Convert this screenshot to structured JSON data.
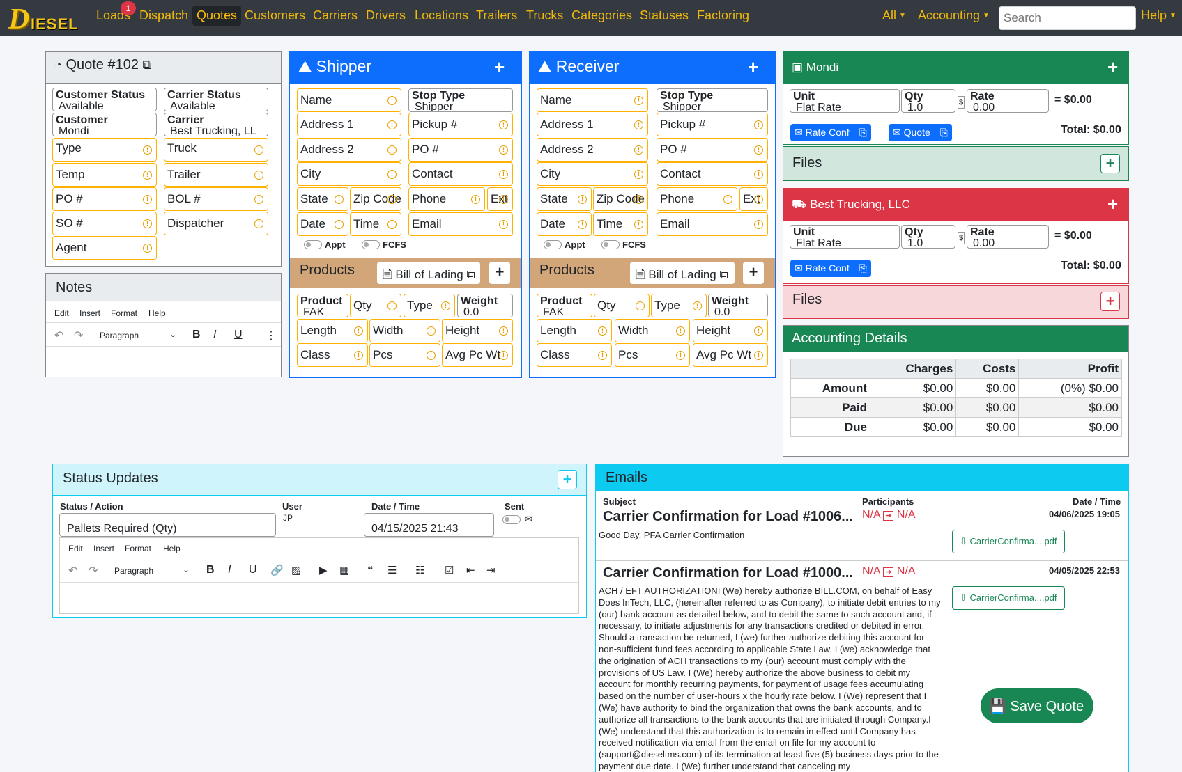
{
  "nav": {
    "logo": "DIESEL",
    "items": [
      "Loads",
      "Dispatch",
      "Quotes",
      "Customers",
      "Carriers",
      "Drivers",
      "Locations",
      "Trailers",
      "Trucks",
      "Categories",
      "Statuses",
      "Factoring"
    ],
    "loads_badge": "1",
    "all": "All",
    "accounting": "Accounting",
    "search_placeholder": "Search",
    "help": "Help"
  },
  "quote": {
    "title": "Quote #102",
    "customer_status_label": "Customer Status",
    "customer_status": "Available",
    "carrier_status_label": "Carrier Status",
    "carrier_status": "Available",
    "customer_label": "Customer",
    "customer": "Mondi",
    "carrier_label": "Carrier",
    "carrier": "Best Trucking, LL",
    "type": "Type",
    "truck": "Truck",
    "temp": "Temp",
    "trailer": "Trailer",
    "po": "PO #",
    "bol": "BOL #",
    "so": "SO #",
    "dispatcher": "Dispatcher",
    "agent": "Agent"
  },
  "notes": {
    "title": "Notes",
    "menu": [
      "Edit",
      "Insert",
      "Format",
      "Help"
    ],
    "paragraph": "Paragraph"
  },
  "shipper": {
    "title": "Shipper",
    "name": "Name",
    "stop_type_label": "Stop Type",
    "stop_type": "Shipper",
    "address1": "Address 1",
    "pickup": "Pickup #",
    "address2": "Address 2",
    "po": "PO #",
    "city": "City",
    "contact": "Contact",
    "state": "State",
    "zip": "Zip Code",
    "phone": "Phone",
    "ext": "Ext",
    "date": "Date",
    "time": "Time",
    "email": "Email",
    "appt": "Appt",
    "fcfs": "FCFS"
  },
  "receiver": {
    "title": "Receiver",
    "name": "Name",
    "stop_type_label": "Stop Type",
    "stop_type": "Shipper",
    "address1": "Address 1",
    "pickup": "Pickup #",
    "address2": "Address 2",
    "po": "PO #",
    "city": "City",
    "contact": "Contact",
    "state": "State",
    "zip": "Zip Code",
    "phone": "Phone",
    "ext": "Ext",
    "date": "Date",
    "time": "Time",
    "email": "Email",
    "appt": "Appt",
    "fcfs": "FCFS"
  },
  "products": {
    "title": "Products",
    "bol": "Bill of Lading",
    "product_label": "Product",
    "product": "FAK",
    "qty": "Qty",
    "type": "Type",
    "weight_label": "Weight",
    "weight": "0.0",
    "length": "Length",
    "width": "Width",
    "height": "Height",
    "class": "Class",
    "pcs": "Pcs",
    "avg": "Avg Pc Wt"
  },
  "mondi": {
    "title": "Mondi",
    "unit_label": "Unit",
    "unit": "Flat Rate",
    "qty_label": "Qty",
    "qty": "1.0",
    "rate_label": "Rate",
    "rate": "0.00",
    "dollar": "$",
    "line_total": "= $0.00",
    "rate_conf": "Rate Conf",
    "quote": "Quote",
    "total": "Total: $0.00",
    "files": "Files"
  },
  "best": {
    "title": "Best Trucking, LLC",
    "unit_label": "Unit",
    "unit": "Flat Rate",
    "qty_label": "Qty",
    "qty": "1.0",
    "rate_label": "Rate",
    "rate": "0.00",
    "dollar": "$",
    "line_total": "= $0.00",
    "rate_conf": "Rate Conf",
    "total": "Total: $0.00",
    "files": "Files"
  },
  "accounting": {
    "title": "Accounting Details",
    "cols": [
      "Charges",
      "Costs",
      "Profit"
    ],
    "rows": [
      {
        "label": "Amount",
        "charges": "$0.00",
        "costs": "$0.00",
        "profit": "(0%) $0.00"
      },
      {
        "label": "Paid",
        "charges": "$0.00",
        "costs": "$0.00",
        "profit": "$0.00"
      },
      {
        "label": "Due",
        "charges": "$0.00",
        "costs": "$0.00",
        "profit": "$0.00"
      }
    ]
  },
  "status": {
    "title": "Status Updates",
    "col_action": "Status / Action",
    "col_user": "User",
    "col_date": "Date / Time",
    "col_sent": "Sent",
    "action": "Pallets Required (Qty)",
    "user": "JP",
    "date": "04/15/2025 21:43",
    "menu": [
      "Edit",
      "Insert",
      "Format",
      "Help"
    ],
    "paragraph": "Paragraph"
  },
  "emails": {
    "title": "Emails",
    "col_subject": "Subject",
    "col_participants": "Participants",
    "col_date": "Date / Time",
    "items": [
      {
        "subject": "Carrier Confirmation for Load #1006...",
        "from": "N/A",
        "to": "N/A",
        "date": "04/06/2025 19:05",
        "body": "Good Day, PFA Carrier Confirmation",
        "file": "CarrierConfirma....pdf"
      },
      {
        "subject": "Carrier Confirmation for Load #1000...",
        "from": "N/A",
        "to": "N/A",
        "date": "04/05/2025 22:53",
        "body": "ACH / EFT AUTHORIZATIONI (We) hereby authorize BILL.COM, on behalf of Easy Does InTech, LLC, (hereinafter referred to as Company), to initiate debit entries to my (our) bank account as detailed below, and to debit the same to such account and, if necessary, to initiate adjustments for any transactions credited or debited in error. Should a transaction be returned, I (we) further authorize debiting this account for non-sufficient fund fees according to applicable State Law. I (we) acknowledge that the origination of ACH transactions to my (our) account must comply with the provisions of US Law. I (We) hereby authorize the above business to debit my account for monthly recurring payments, for payment of usage fees accumulating based on the number of user-hours x the hourly rate below. I (We) represent that I (We) have authority to bind the organization that owns the bank accounts, and to authorize all transactions to the bank accounts that are initiated through Company.I (We) understand that this authorization is to remain in effect until Company has received notification via email from the email on file for my account to (support@dieseltms.com) of its termination at least five (5) business days prior to the payment due date. I (We) further understand that canceling my",
        "file": "CarrierConfirma....pdf"
      }
    ]
  },
  "save": "Save Quote",
  "colors": {
    "nav": "#343a40",
    "accent": "#f0b90b",
    "blue": "#0d6efd",
    "green": "#198754",
    "red": "#dc3545",
    "cyan": "#0dcaf0",
    "tan": "#d2a679"
  }
}
